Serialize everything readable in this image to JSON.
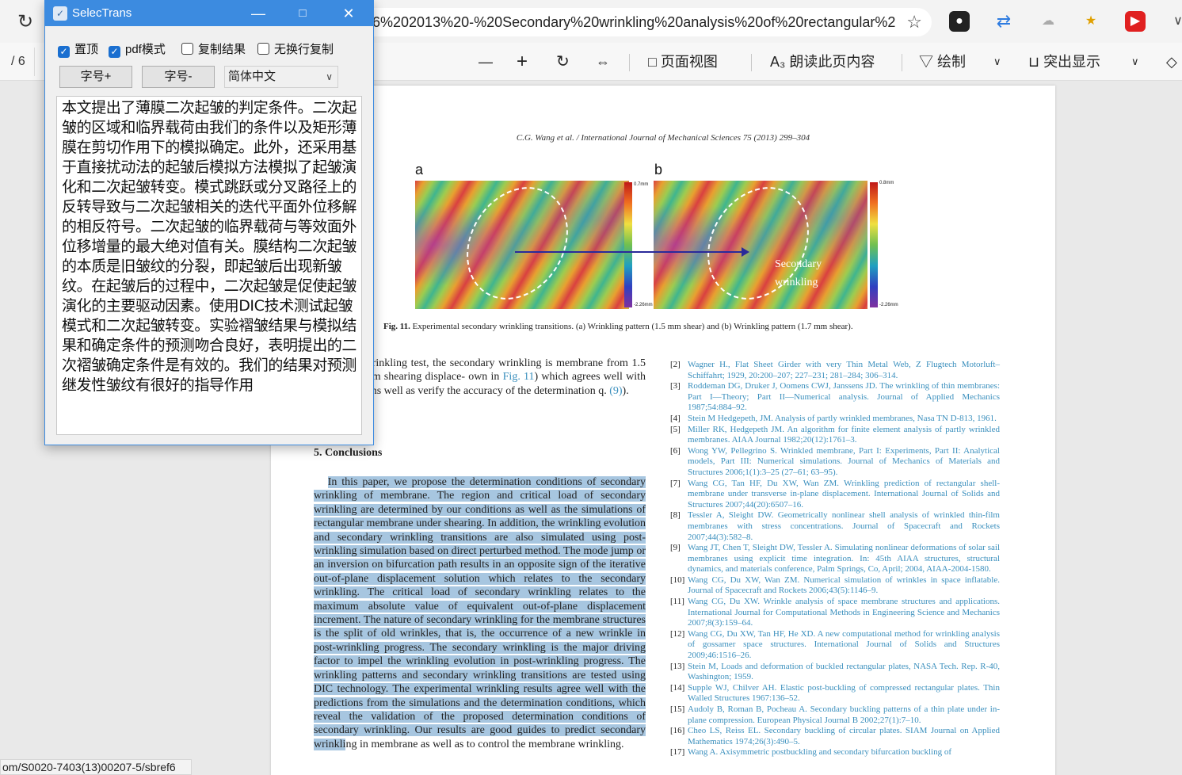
{
  "browser": {
    "url": "6%202013%20-%20Secondary%20wrinkling%20analysis%20of%20rectangular%20...",
    "status_url": "om/S0020-7403(13)00207-5/sbref6"
  },
  "pdf_toolbar": {
    "page_total": "/ 6",
    "zoom_out": "—",
    "zoom_in": "+",
    "page_view": "页面视图",
    "read_aloud": "朗读此页内容",
    "draw": "绘制",
    "highlight": "突出显示"
  },
  "pdf": {
    "running_head": "C.G. Wang et al. / International Journal of Mechanical Sciences 75 (2013) 299–304",
    "fig_label_a": "a",
    "fig_label_b": "b",
    "cbar_a_top": "0.7mm",
    "cbar_a_bottom": "-2.26mm",
    "cbar_b_top": "0.8mm",
    "cbar_b_bottom": "-2.26mm",
    "fig_annotation_1": "Secondary",
    "fig_annotation_2": "wrinkling",
    "caption_label": "Fig. 11.",
    "caption_text": "Experimental secondary wrinkling transitions. (a) Wrinkling pattern (1.5 mm shear) and (b) Wrinkling pattern (1.7 mm shear).",
    "left_para": {
      "part1": "n shearing wrinkling test, the secondary wrinkling is membrane from 1.5 mm to 1.7 mm shearing displace- own in ",
      "link1": "Fig. 11",
      "part2": ") which agrees well with the simulations well as verify the accuracy of the determination q. ",
      "link2": "(9)",
      "part3": ")."
    },
    "section_heading": "5.  Conclusions",
    "conclusion_highlighted": "In this paper, we propose the determination conditions of secondary wrinkling of membrane. The region and critical load of secondary wrinkling are determined by our conditions as well as the simulations of rectangular membrane under shearing. In addition, the wrinkling evolution and secondary wrinkling transitions are also simulated using post-wrinkling simulation based on direct perturbed method. The mode jump or an inversion on bifurcation path results in an opposite sign of the iterative out-of-plane displacement solution which relates to the secondary wrinkling. The critical load of secondary wrinkling relates to the maximum absolute value of equivalent out-of-plane displacement increment. The nature of secondary wrinkling for the membrane structures is the split of old wrinkles, that is, the occurrence of a new wrinkle in post-wrinkling progress. The secondary wrinkling is the major driving factor to impel the wrinkling evolution in post-wrinkling progress. The wrinkling patterns and secondary wrinkling transitions are tested using DIC technology. The experimental wrinkling results agree well with the predictions from the simulations and the determination conditions, which reveal the validation of the proposed determination conditions of secondary wrinkling. Our results are good guides to predict secondary wrinkli",
    "conclusion_plain": "ng in membrane as well as to control the membrane wrinkling.",
    "references": [
      {
        "num": "[2]",
        "text": "Wagner H., Flat Sheet Girder with very Thin Metal Web, Z Flugtech Motorluft–Schiffahrt; 1929, 20:200–207; 227–231; 281–284; 306–314."
      },
      {
        "num": "[3]",
        "text": "Roddeman DG, Druker J, Oomens CWJ, Janssens JD. The wrinkling of thin membranes: Part I—Theory; Part II—Numerical analysis. Journal of Applied Mechanics 1987;54:884–92."
      },
      {
        "num": "[4]",
        "text": "Stein M Hedgepeth, JM. Analysis of partly wrinkled membranes, Nasa TN D-813, 1961."
      },
      {
        "num": "[5]",
        "text": "Miller RK, Hedgepeth JM. An algorithm for finite element analysis of partly wrinkled membranes. AIAA Journal 1982;20(12):1761–3."
      },
      {
        "num": "[6]",
        "text": "Wong YW, Pellegrino S. Wrinkled membrane, Part I: Experiments, Part II: Analytical models, Part III: Numerical simulations. Journal of Mechanics of Materials and Structures 2006;1(1):3–25 (27–61; 63–95)."
      },
      {
        "num": "[7]",
        "text": "Wang CG, Tan HF, Du XW, Wan ZM. Wrinkling prediction of rectangular shell-membrane under transverse in-plane displacement. International Journal of Solids and Structures 2007;44(20):6507–16."
      },
      {
        "num": "[8]",
        "text": "Tessler A, Sleight DW. Geometrically nonlinear shell analysis of wrinkled thin-film membranes with stress concentrations. Journal of Spacecraft and Rockets 2007;44(3):582–8."
      },
      {
        "num": "[9]",
        "text": "Wang JT, Chen T, Sleight DW, Tessler A. Simulating nonlinear deformations of solar sail membranes using explicit time integration. In: 45th AIAA structures, structural dynamics, and materials conference, Palm Springs, Co, April; 2004, AIAA-2004-1580."
      },
      {
        "num": "[10]",
        "text": "Wang CG, Du XW, Wan ZM. Numerical simulation of wrinkles in space inflatable. Journal of Spacecraft and Rockets 2006;43(5):1146–9."
      },
      {
        "num": "[11]",
        "text": "Wang CG, Du XW. Wrinkle analysis of space membrane structures and applications. International Journal for Computational Methods in Engineering Science and Mechanics 2007;8(3):159–64."
      },
      {
        "num": "[12]",
        "text": "Wang CG, Du XW, Tan HF, He XD. A new computational method for wrinkling analysis of gossamer space structures. International Journal of Solids and Structures 2009;46:1516–26."
      },
      {
        "num": "[13]",
        "text": "Stein M, Loads and deformation of buckled rectangular plates, NASA Tech. Rep. R-40, Washington; 1959."
      },
      {
        "num": "[14]",
        "text": "Supple WJ, Chilver AH. Elastic post-buckling of compressed rectangular plates. Thin Walled Structures 1967:136–52."
      },
      {
        "num": "[15]",
        "text": "Audoly B, Roman B, Pocheau A. Secondary buckling patterns of a thin plate under in-plane compression. European Physical Journal B 2002;27(1):7–10."
      },
      {
        "num": "[16]",
        "text": "Cheo LS, Reiss EL. Secondary buckling of circular plates. SIAM Journal on Applied Mathematics 1974;26(3):490–5."
      },
      {
        "num": "[17]",
        "text": "Wang A. Axisymmetric postbuckling and secondary bifurcation buckling of"
      }
    ]
  },
  "selectrans": {
    "title": "SelecTrans",
    "options": [
      {
        "label": "置顶",
        "checked": true
      },
      {
        "label": "pdf模式",
        "checked": true
      },
      {
        "label": "复制结果",
        "checked": false
      },
      {
        "label": "无换行复制",
        "checked": false
      }
    ],
    "font_up": "字号+",
    "font_down": "字号-",
    "language": "简体中文",
    "translation": "  本文提出了薄膜二次起皱的判定条件。二次起皱的区域和临界载荷由我们的条件以及矩形薄膜在剪切作用下的模拟确定。此外，还采用基于直接扰动法的起皱后模拟方法模拟了起皱演化和二次起皱转变。模式跳跃或分叉路径上的反转导致与二次起皱相关的迭代平面外位移解的相反符号。二次起皱的临界载荷与等效面外位移增量的最大绝对值有关。膜结构二次起皱的本质是旧皱纹的分裂，即起皱后出现新皱纹。在起皱后的过程中，二次起皱是促使起皱演化的主要驱动因素。使用DIC技术测试起皱模式和二次起皱转变。实验褶皱结果与模拟结果和确定条件的预测吻合良好，表明提出的二次褶皱确定条件是有效的。我们的结果对预测继发性皱纹有很好的指导作用"
  }
}
